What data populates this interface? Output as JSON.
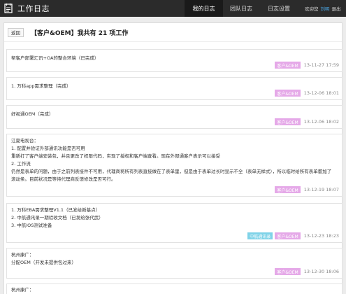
{
  "app": {
    "title": "工作日志"
  },
  "nav": {
    "items": [
      "我的日志",
      "团队日志",
      "日志设置"
    ]
  },
  "user": {
    "welcome": "欢迎您",
    "name": "刘明",
    "logout": "退出"
  },
  "page": {
    "back_label": "返回",
    "title": "【客户&OEM】我共有 21 项工作"
  },
  "entries": [
    {
      "lines": [
        "帮客户部署汇讯+OA的整合环境（已完成）"
      ],
      "tags": [
        "客户&OEM"
      ],
      "time": "13-11-27 17:59"
    },
    {
      "lines": [
        "1. 万科app需求整理（完成）"
      ],
      "tags": [
        "客户&OEM"
      ],
      "time": "13-12-06 18:01"
    },
    {
      "lines": [
        "好视通OEM（完成）"
      ],
      "tags": [
        "客户&OEM"
      ],
      "time": "13-12-06 18:02"
    },
    {
      "lines": [
        "江夏电视台：",
        "1. 配置并验证外部通讯功能是否可用",
        "重新打了客户端安装包，并且更改了权限代码，实现了授权和客户端查看。现在外部通客户表示可以接受",
        "2. 工作流",
        "仍然是表单的问题，由于之前列表接件不可用，代理商将所有列表直接做在了表单里，但是由于表单过长时显示不全（表单无样式），所以临时给所有表单都加了",
        "滚动条。目前状况是等待代理商反馈修改是否可行。"
      ],
      "tags": [
        "客户&OEM"
      ],
      "time": "13-12-19 18:07"
    },
    {
      "lines": [
        "1. 万科EBA需求整理V1.1（已发给新基点）",
        "2. 中航通讯录一期验收文档（已发给张代武）",
        "3. 中航IOS测试准备"
      ],
      "tags": [
        "中航通讯录",
        "客户&OEM"
      ],
      "time": "13-12-23 18:23"
    },
    {
      "lines": [
        "杭州康广：",
        "分配OEM（开发未提供包过来）"
      ],
      "tags": [
        "客户&OEM"
      ],
      "time": "13-12-30 18:06"
    },
    {
      "lines": [
        "杭州康广："
      ],
      "tags": [],
      "time": ""
    }
  ]
}
